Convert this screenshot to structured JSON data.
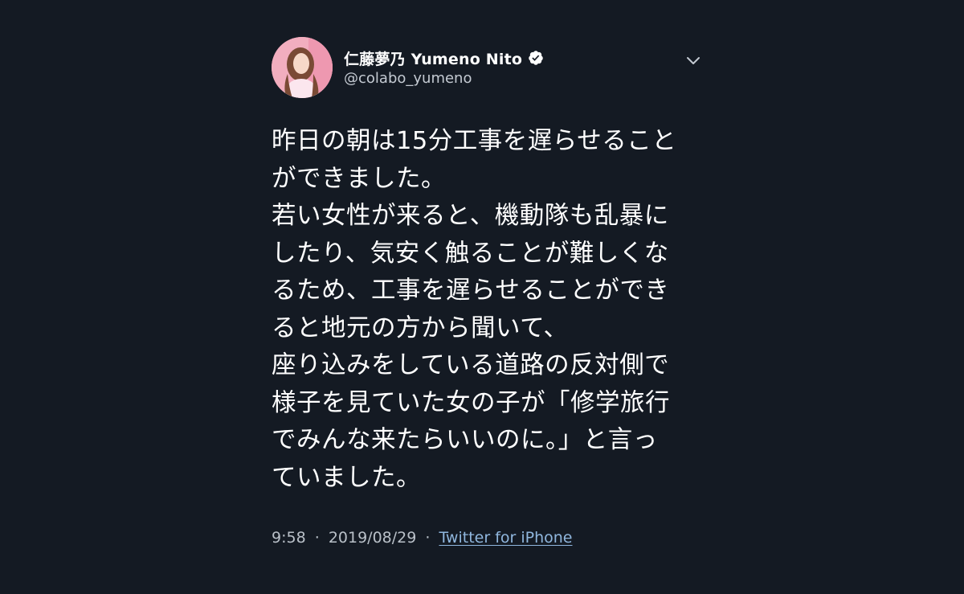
{
  "tweet": {
    "author": {
      "display_name": "仁藤夢乃 Yumeno Nito",
      "handle": "@colabo_yumeno",
      "verified": true,
      "avatar_icon": "avatar-photo"
    },
    "menu_icon": "chevron-down-icon",
    "text_lines": [
      "昨日の朝は15分工事を遅らせること",
      "ができました。",
      "若い女性が来ると、機動隊も乱暴に",
      "したり、気安く触ることが難しくな",
      "るため、工事を遅らせることができ",
      "ると地元の方から聞いて、",
      "座り込みをしている道路の反対側で",
      "様子を見ていた女の子が「修学旅行",
      "でみんな来たらいいのに。」と言っ",
      "ていました。"
    ],
    "meta": {
      "time": "9:58",
      "separator": "·",
      "date": "2019/08/29",
      "source": "Twitter for iPhone"
    }
  },
  "colors": {
    "background": "#141a23",
    "text": "#ffffff",
    "secondary_text": "#c4cad2",
    "link": "#90b7de",
    "verified_badge": "#ffffff"
  }
}
